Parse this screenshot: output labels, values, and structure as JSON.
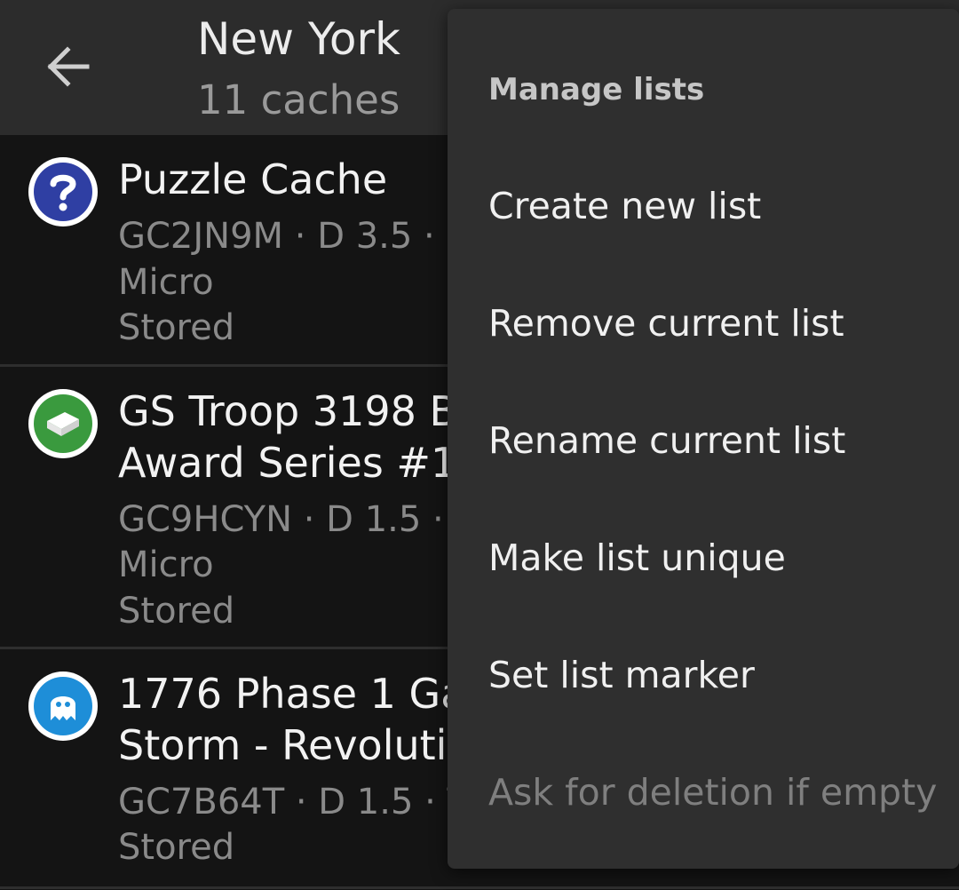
{
  "header": {
    "title": "New York",
    "subtitle": "11 caches",
    "back_icon": "arrow-left-icon"
  },
  "caches": [
    {
      "name": "Puzzle Cache",
      "line1": "GC2JN9M · D 3.5 ·",
      "line2": "Micro",
      "line3": "Stored",
      "icon": "question-mark-icon",
      "icon_color": "#2f3fa3"
    },
    {
      "name": "GS Troop 3198 B",
      "name2": "Award Series #1",
      "line1": "GC9HCYN · D 1.5 ·",
      "line2": "Micro",
      "line3": "Stored",
      "icon": "box-icon",
      "icon_color": "#3a9a3e"
    },
    {
      "name": "1776 Phase 1 Ga",
      "name2": "Storm - Revolutic",
      "line1": "GC7B64T · D 1.5 · T",
      "line2": "Stored",
      "icon": "ghost-icon",
      "icon_color": "#1e8ed8"
    }
  ],
  "menu": {
    "header": "Manage lists",
    "items": [
      {
        "label": "Create new list",
        "enabled": true
      },
      {
        "label": "Remove current list",
        "enabled": true
      },
      {
        "label": "Rename current list",
        "enabled": true
      },
      {
        "label": "Make list unique",
        "enabled": true
      },
      {
        "label": "Set list marker",
        "enabled": true
      },
      {
        "label": "Ask for deletion if empty",
        "enabled": false
      }
    ]
  },
  "colors": {
    "background": "#141414",
    "appbar": "#2c2c2c",
    "menu": "#2f2f2f"
  }
}
